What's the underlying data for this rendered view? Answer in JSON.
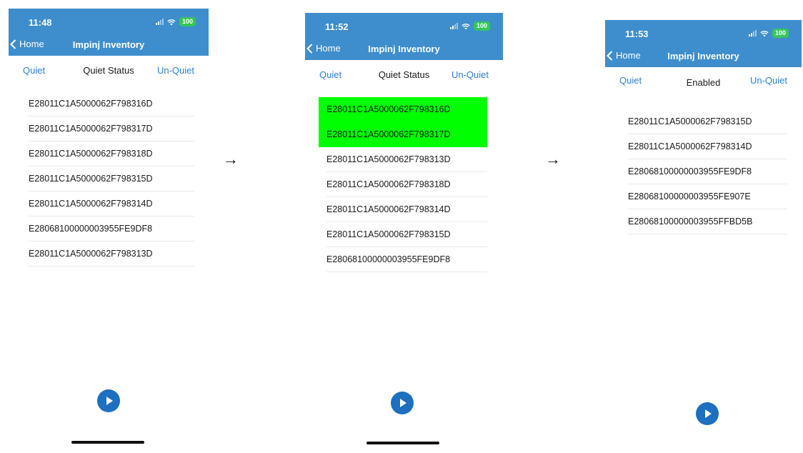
{
  "common": {
    "back_label": "Home",
    "title": "Impinj Inventory",
    "quiet_label": "Quiet",
    "unquiet_label": "Un-Quiet",
    "battery": "100"
  },
  "arrows": [
    "→",
    "→"
  ],
  "phones": [
    {
      "time": "11:48",
      "status": "Quiet Status",
      "tags": [
        "E28011C1A5000062F798316D",
        "E28011C1A5000062F798317D",
        "E28011C1A5000062F798318D",
        "E28011C1A5000062F798315D",
        "E28011C1A5000062F798314D",
        "E28068100000003955FE9DF8",
        "E28011C1A5000062F798313D"
      ]
    },
    {
      "time": "11:52",
      "status": "Quiet Status",
      "highlight_color": "#00ff00",
      "highlighted_tags": [
        0,
        1
      ],
      "tags": [
        "E28011C1A5000062F798316D",
        "E28011C1A5000062F798317D",
        "E28011C1A5000062F798313D",
        "E28011C1A5000062F798318D",
        "E28011C1A5000062F798314D",
        "E28011C1A5000062F798315D",
        "E28068100000003955FE9DF8"
      ]
    },
    {
      "time": "11:53",
      "status": "Enabled",
      "tags": [
        "E28011C1A5000062F798315D",
        "E28011C1A5000062F798314D",
        "E28068100000003955FE9DF8",
        "E28068100000003955FE907E",
        "E28068100000003955FFBD5B"
      ]
    }
  ],
  "colors": {
    "nav_bar": "#3e8ecd",
    "link": "#2f7fd0",
    "play_button": "#1d6fbf",
    "highlight": "#00ff00"
  }
}
